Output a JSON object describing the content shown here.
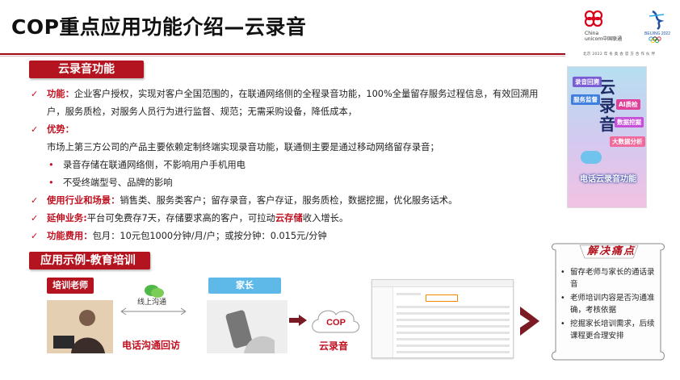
{
  "title": "COP重点应用功能介绍—云录音",
  "logo": {
    "brand_cn": "中国联通",
    "brand_line1": "China",
    "brand_line2": "unicom中国联通",
    "olympic": "BEIJING 2022",
    "partner": "北京 2022 年 冬 奥 会 官 方 合 作 伙 伴"
  },
  "section1": "云录音功能",
  "section2": "应用示例-教育培训",
  "items": {
    "func_lead": "功能：",
    "func_text": "企业客户授权，实现对客户全国范围的，在联通网络侧的全程录音功能，100%全量留存服务过程信息，有效回溯用户，服务质检，对服务人员行为进行监督、规范；无需采购设备，降低成本，",
    "adv_lead": "优势：",
    "adv_text": "市场上第三方公司的产品主要依赖定制终端实现录音功能，联通侧主要是通过移动网络留存录音；",
    "adv_sub1": "录音存储在联通网络侧，不影响用户手机用电",
    "adv_sub2": "不受终端型号、品牌的影响",
    "ind_lead": "使用行业和场景：",
    "ind_text": "销售类、服务类客户；留存录音，客户存证，服务质检，数据挖掘，优化服务话术。",
    "ext_lead": "延伸业务:",
    "ext_text_a": "平台可免费存7天，存储要求高的客户，可拉动",
    "ext_red": "云存储",
    "ext_text_b": "收入增长。",
    "fee_lead": "功能费用：",
    "fee_text": "包月：10元包1000分钟/月/户；或按分钟：0.015元/分钟"
  },
  "poster": {
    "big": "云录音",
    "tag1": "AI质检",
    "tag2": "数据挖掘",
    "tag3": "大数据分析",
    "tag4": "服务监督",
    "tag5": "录音回溯",
    "bottom": "电话云录音功能"
  },
  "scenario": {
    "teacher": "培训老师",
    "parent": "家长",
    "online": "线上沟通",
    "phone": "电话沟通回访",
    "cop": "COP",
    "cop_label": "云录音"
  },
  "pain": {
    "title": "解决痛点",
    "points": [
      "留存老师与家长的通话录音",
      "老师培训内容是否沟通准确，考核依据",
      "挖掘家长培训需求，后续课程更合理安排"
    ]
  },
  "colors": {
    "accent": "#b3141f",
    "blue": "#5fb9e8"
  }
}
